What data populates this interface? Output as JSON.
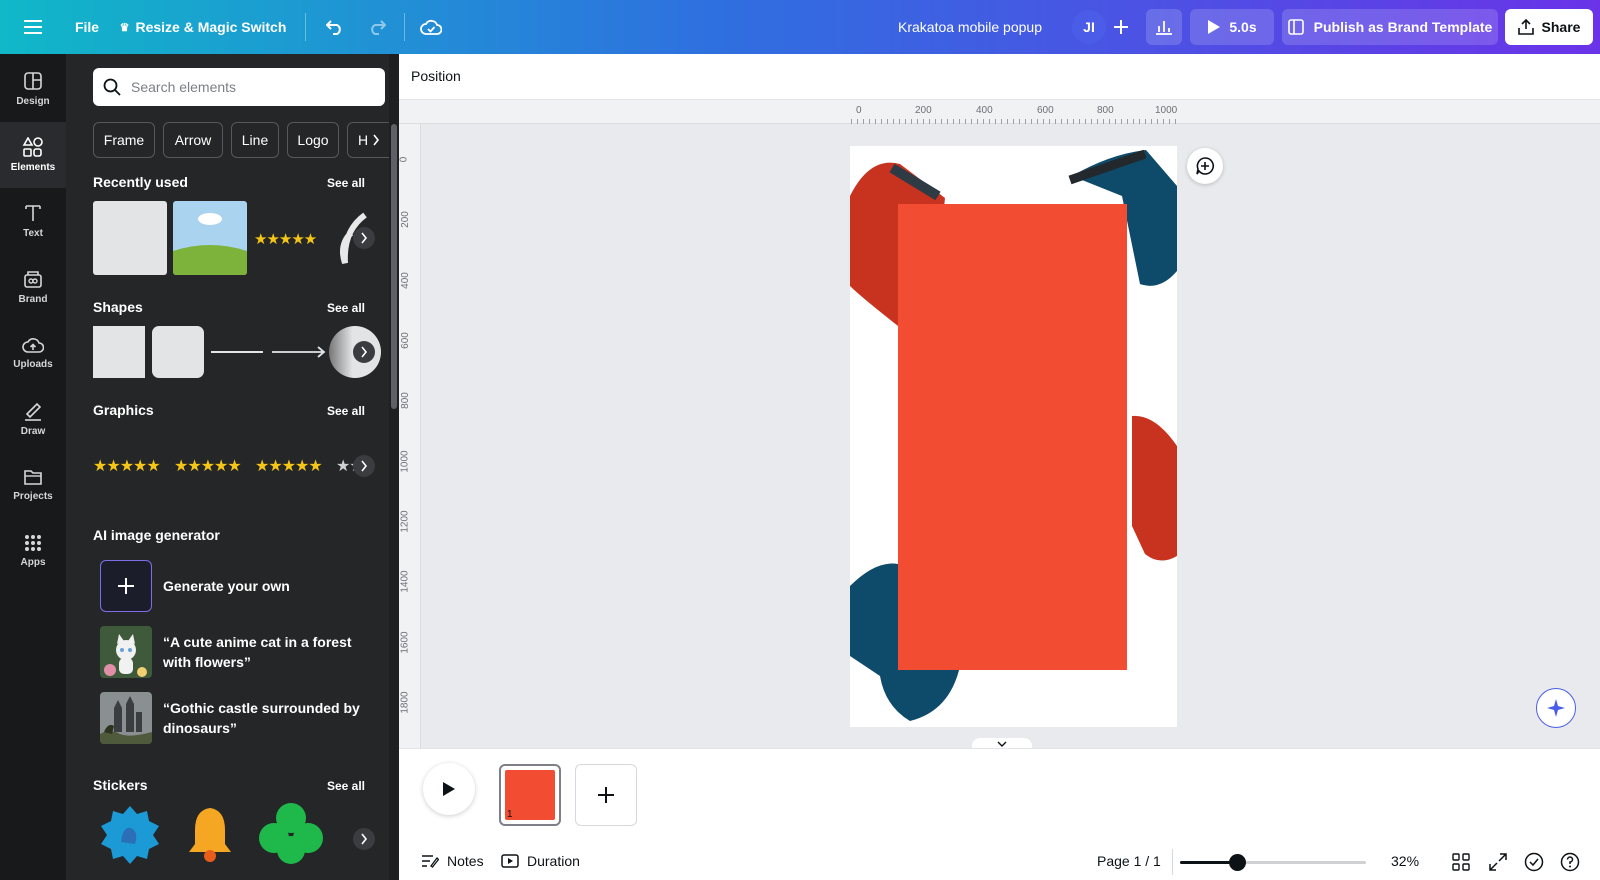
{
  "topbar": {
    "file_label": "File",
    "resize_label": "Resize & Magic Switch",
    "doc_title": "Krakatoa mobile popup",
    "avatar_initials": "JI",
    "play_label": "5.0s",
    "publish_label": "Publish as Brand Template",
    "share_label": "Share"
  },
  "rail": {
    "items": [
      {
        "label": "Design",
        "icon": "design-icon"
      },
      {
        "label": "Elements",
        "icon": "elements-icon"
      },
      {
        "label": "Text",
        "icon": "text-icon"
      },
      {
        "label": "Brand",
        "icon": "brand-icon"
      },
      {
        "label": "Uploads",
        "icon": "uploads-icon"
      },
      {
        "label": "Draw",
        "icon": "draw-icon"
      },
      {
        "label": "Projects",
        "icon": "projects-icon"
      },
      {
        "label": "Apps",
        "icon": "apps-icon"
      }
    ]
  },
  "panel": {
    "search_placeholder": "Search elements",
    "chips": [
      "Frame",
      "Arrow",
      "Line",
      "Logo",
      "H"
    ],
    "recently_used": {
      "title": "Recently used",
      "see_all": "See all"
    },
    "shapes": {
      "title": "Shapes",
      "see_all": "See all"
    },
    "graphics": {
      "title": "Graphics",
      "see_all": "See all"
    },
    "ai": {
      "title": "AI image generator",
      "generate": "Generate your own",
      "prompt1": "“A cute anime cat in a forest with flowers”",
      "prompt2": "“Gothic castle surrounded by dinosaurs”"
    },
    "stickers": {
      "title": "Stickers",
      "see_all": "See all"
    }
  },
  "editor": {
    "position_label": "Position",
    "ruler_h": [
      "0",
      "200",
      "400",
      "600",
      "800",
      "1000"
    ],
    "ruler_v": [
      "0",
      "200",
      "400",
      "600",
      "800",
      "1000",
      "1200",
      "1400",
      "1600",
      "1800"
    ],
    "canvas_color": "#f24c33",
    "page_number": "1"
  },
  "bottom": {
    "notes_label": "Notes",
    "duration_label": "Duration",
    "page_indicator": "Page 1 / 1",
    "zoom_label": "32%",
    "zoom_value": 0.32
  }
}
